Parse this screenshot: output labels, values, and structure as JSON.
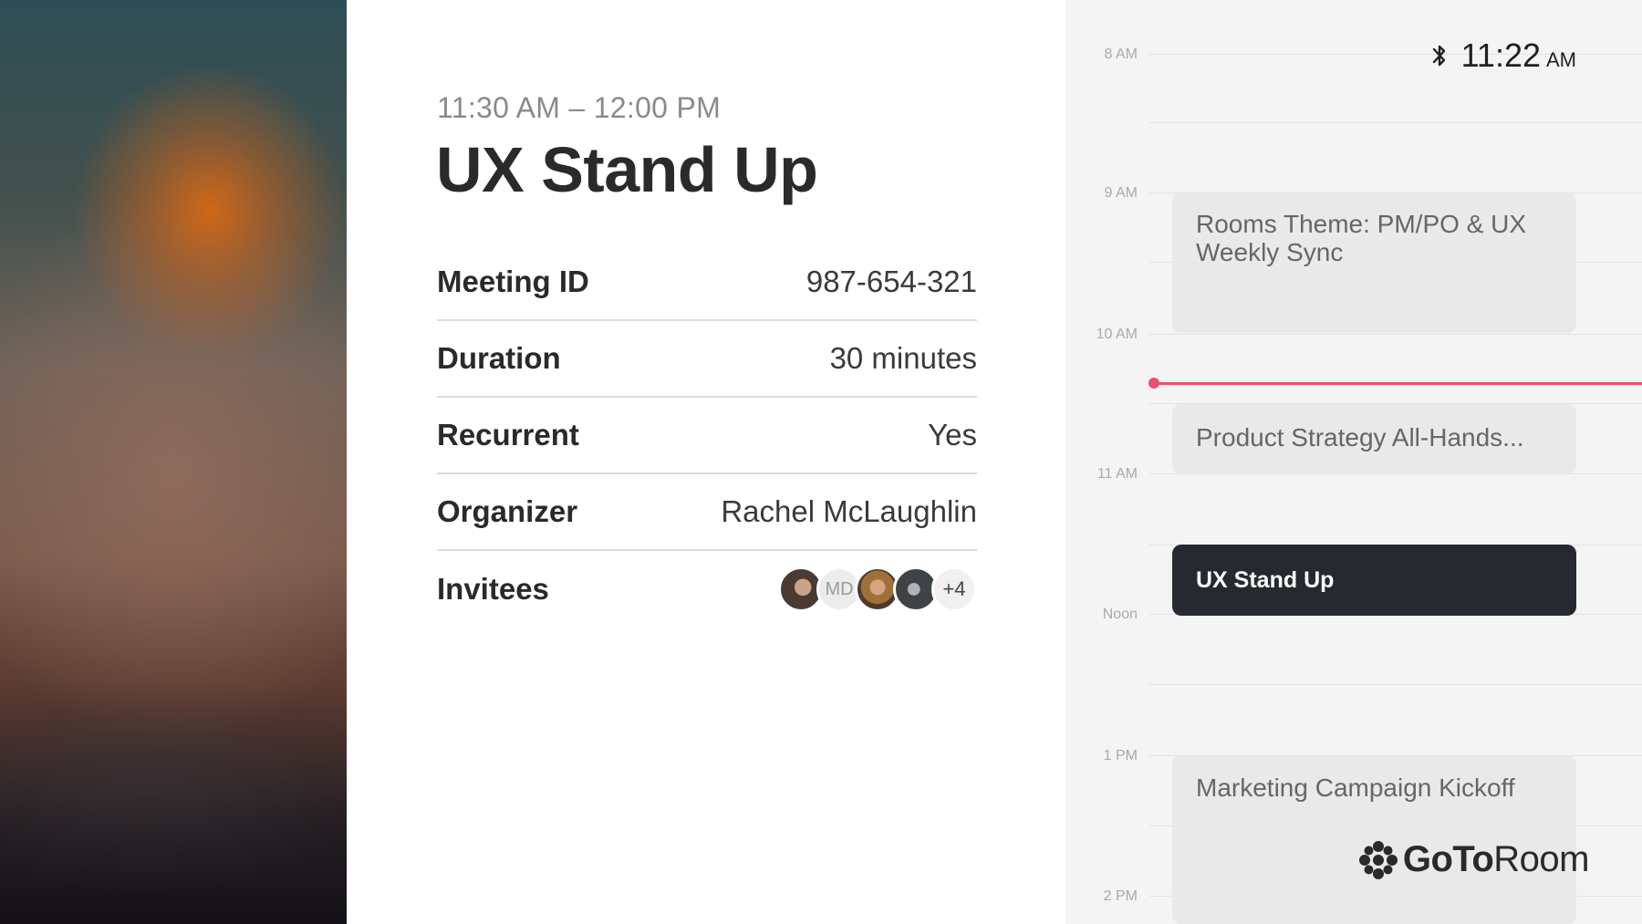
{
  "meeting": {
    "time_range": "11:30 AM – 12:00 PM",
    "title": "UX Stand Up",
    "details": [
      {
        "label": "Meeting ID",
        "value": "987-654-321"
      },
      {
        "label": "Duration",
        "value": "30 minutes"
      },
      {
        "label": "Recurrent",
        "value": "Yes"
      },
      {
        "label": "Organizer",
        "value": "Rachel McLaughlin"
      }
    ],
    "invitees": {
      "label": "Invitees",
      "initials": "MD",
      "more": "+4"
    }
  },
  "schedule": {
    "hours": [
      "8 AM",
      "9 AM",
      "10 AM",
      "11 AM",
      "Noon",
      "1 PM",
      "2 PM"
    ],
    "events": [
      {
        "title": "Rooms Theme: PM/PO & UX Weekly Sync"
      },
      {
        "title": "Product Strategy All-Hands..."
      },
      {
        "title": "UX Stand Up",
        "active": true
      },
      {
        "title": "Marketing Campaign Kickoff"
      }
    ],
    "now_indicator_color": "#e8526a"
  },
  "status_bar": {
    "time": "11:22",
    "ampm": "AM",
    "icon": "bluetooth-icon"
  },
  "brand": {
    "name_bold": "GoTo",
    "name_light": "Room",
    "icon": "goto-logo-icon"
  },
  "colors": {
    "active_event_bg": "#262a30",
    "event_bg": "#e9e9e9",
    "panel_bg": "#f4f4f4"
  }
}
